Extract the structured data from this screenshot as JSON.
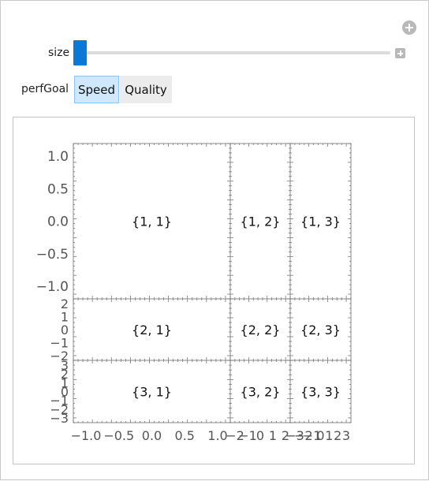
{
  "controls": {
    "size_label": "size",
    "size_value": 0,
    "perfGoal_label": "perfGoal",
    "perfGoal_options": [
      "Speed",
      "Quality"
    ],
    "perfGoal_selected": "Speed"
  },
  "chart_data": {
    "type": "grid",
    "rows": [
      {
        "y_ticks": [
          "1.0",
          "0.5",
          "0.0",
          "−0.5",
          "−1.0"
        ],
        "cells": [
          "{1, 1}",
          "{1, 2}",
          "{1, 3}"
        ]
      },
      {
        "y_ticks": [
          "2",
          "1",
          "0",
          "−1",
          "−2"
        ],
        "cells": [
          "{2, 1}",
          "{2, 2}",
          "{2, 3}"
        ]
      },
      {
        "y_ticks": [
          "3",
          "2",
          "1",
          "0",
          "−1",
          "−2",
          "−3"
        ],
        "cells": [
          "{3, 1}",
          "{3, 2}",
          "{3, 3}"
        ]
      }
    ],
    "x_ticks": [
      [
        "−1.0",
        "−0.5",
        "0.0",
        "0.5",
        "1.0"
      ],
      [
        "−2",
        "−1",
        "0",
        "1",
        "2"
      ],
      [
        "−3",
        "−2",
        "−1",
        "0",
        "1",
        "2",
        "3"
      ]
    ]
  }
}
